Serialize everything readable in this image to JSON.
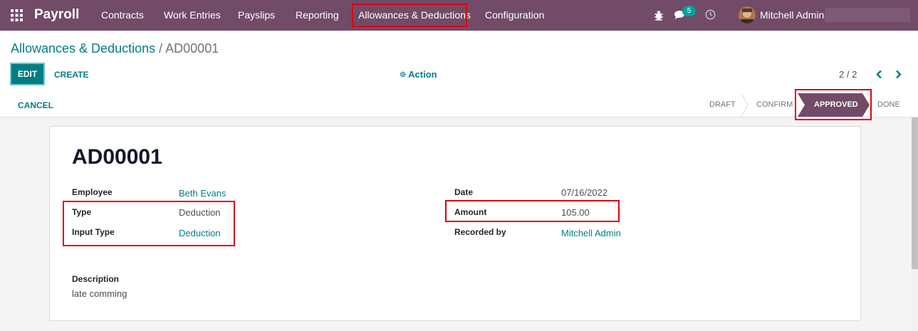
{
  "topbar": {
    "app_title": "Payroll",
    "menu": [
      "Contracts",
      "Work Entries",
      "Payslips",
      "Reporting",
      "Allowances & Deductions",
      "Configuration"
    ],
    "messages_count": "5",
    "user_name": "Mitchell Admin"
  },
  "breadcrumb": {
    "parent": "Allowances & Deductions",
    "separator": "/",
    "current": "AD00001"
  },
  "control": {
    "edit_label": "EDIT",
    "create_label": "CREATE",
    "action_label": "Action",
    "pager": "2 / 2"
  },
  "status": {
    "cancel_label": "CANCEL",
    "stages": [
      "DRAFT",
      "CONFIRM",
      "APPROVED",
      "DONE"
    ],
    "active_stage": "APPROVED"
  },
  "record": {
    "title": "AD00001",
    "labels": {
      "employee": "Employee",
      "type": "Type",
      "input_type": "Input Type",
      "date": "Date",
      "amount": "Amount",
      "recorded_by": "Recorded by",
      "description": "Description"
    },
    "employee": "Beth Evans",
    "type": "Deduction",
    "input_type": "Deduction",
    "date": "07/16/2022",
    "amount": "105.00",
    "recorded_by": "Mitchell Admin",
    "description": "late comming"
  },
  "colors": {
    "brand": "#714b67",
    "accent": "#017e84",
    "highlight": "#e0000f"
  }
}
